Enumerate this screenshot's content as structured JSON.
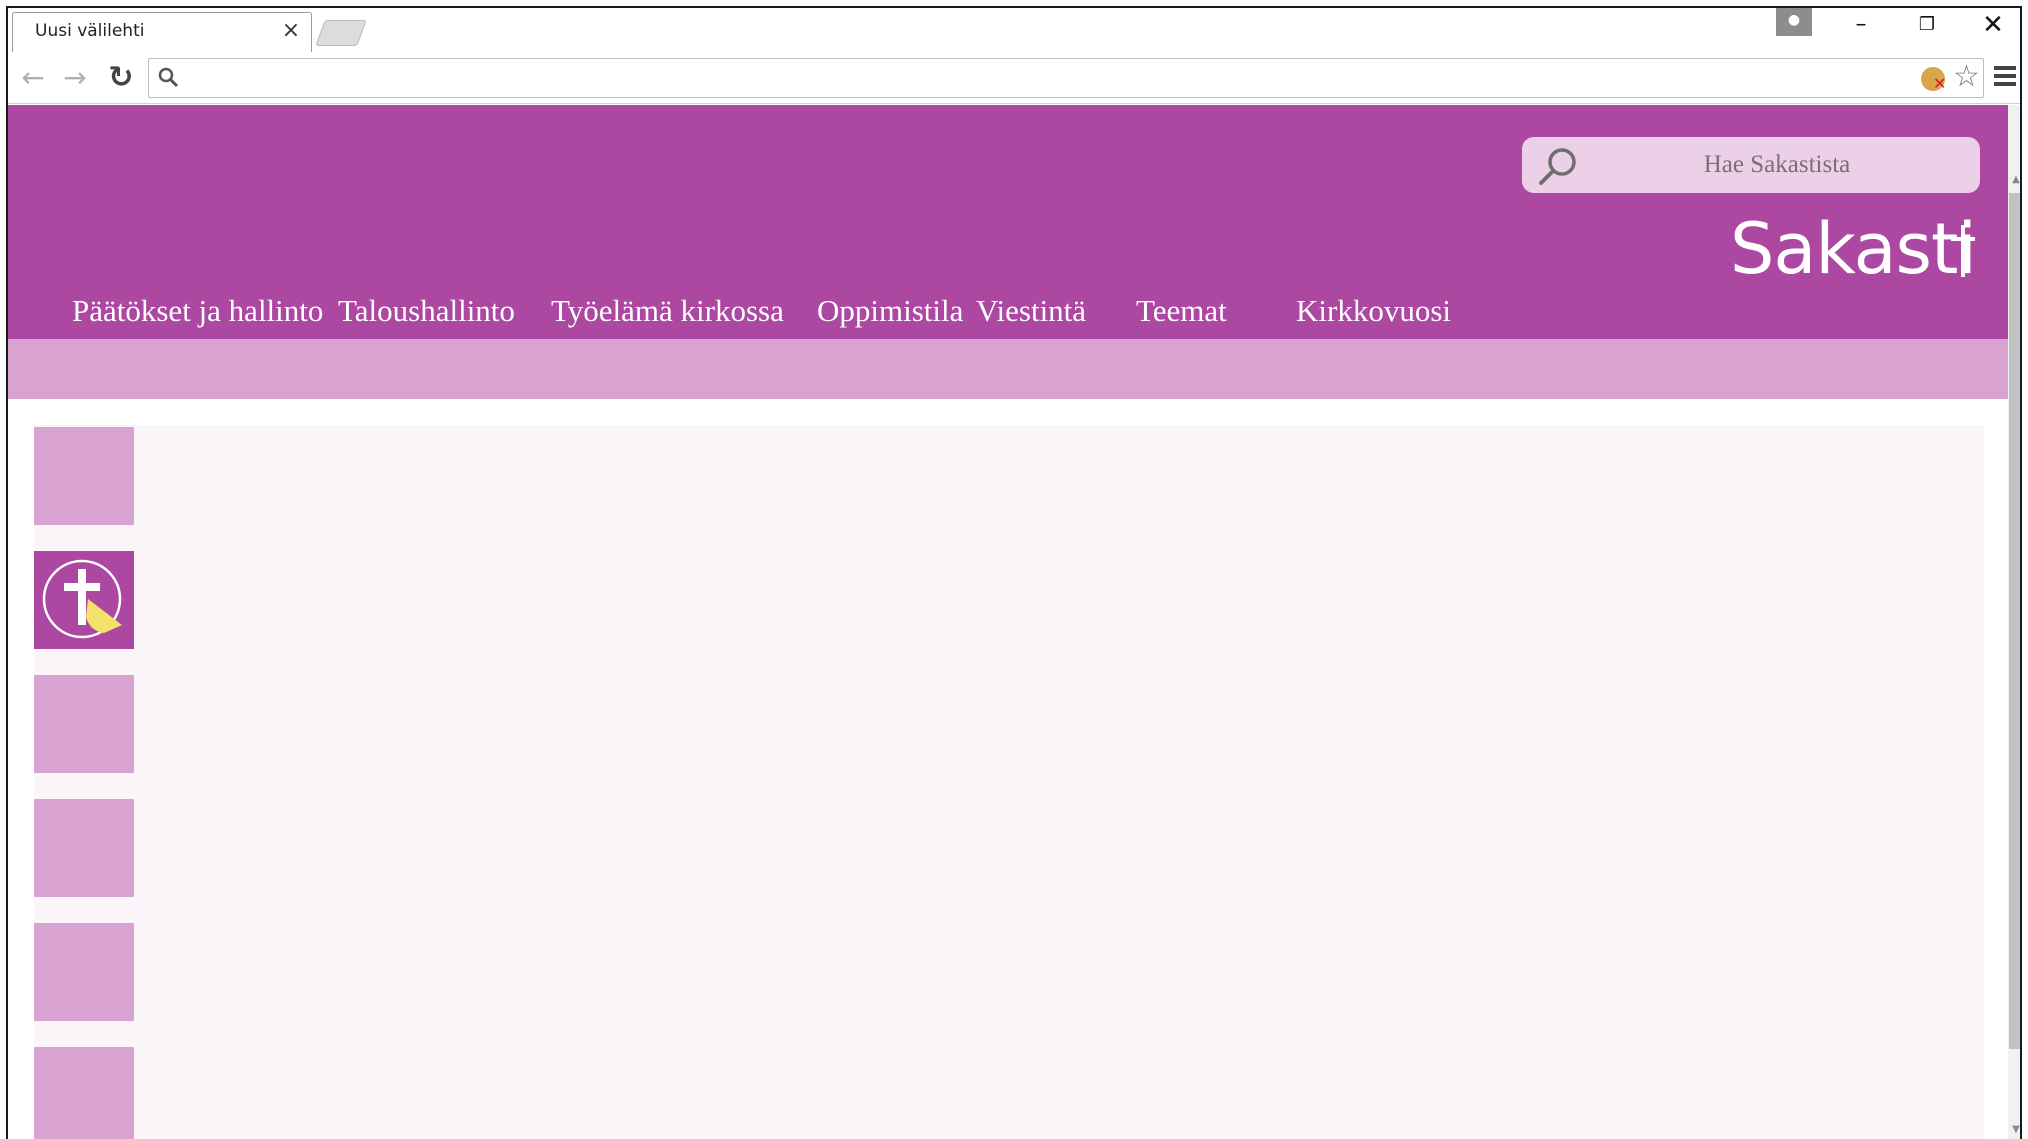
{
  "browser": {
    "tab_title": "Uusi välilehti",
    "tab_close_icon": "×",
    "address_value": "",
    "icons": [
      "back-arrow-icon",
      "forward-arrow-icon",
      "reload-icon",
      "search-icon",
      "extension-blocked-icon",
      "star-icon",
      "menu-icon",
      "profile-icon"
    ]
  },
  "window_controls": {
    "minimize": "–",
    "maximize": "❐",
    "close": "✕"
  },
  "site": {
    "search_placeholder": "Hae Sakastista",
    "logo_text": "Sakasti",
    "nav": [
      {
        "label": "Päätökset ja hallinto"
      },
      {
        "label": "Taloushallinto"
      },
      {
        "label": "Työelämä kirkossa"
      },
      {
        "label": "Oppimistila"
      },
      {
        "label": "Viestintä"
      },
      {
        "label": "Teemat"
      },
      {
        "label": "Kirkkovuosi"
      }
    ],
    "colors": {
      "header": "#ad48a2",
      "subbar": "#d8a2d1",
      "search_bg": "#ecd0e7",
      "content_bg": "#f9f5f9",
      "emblem_accent": "#f3e36a"
    }
  }
}
